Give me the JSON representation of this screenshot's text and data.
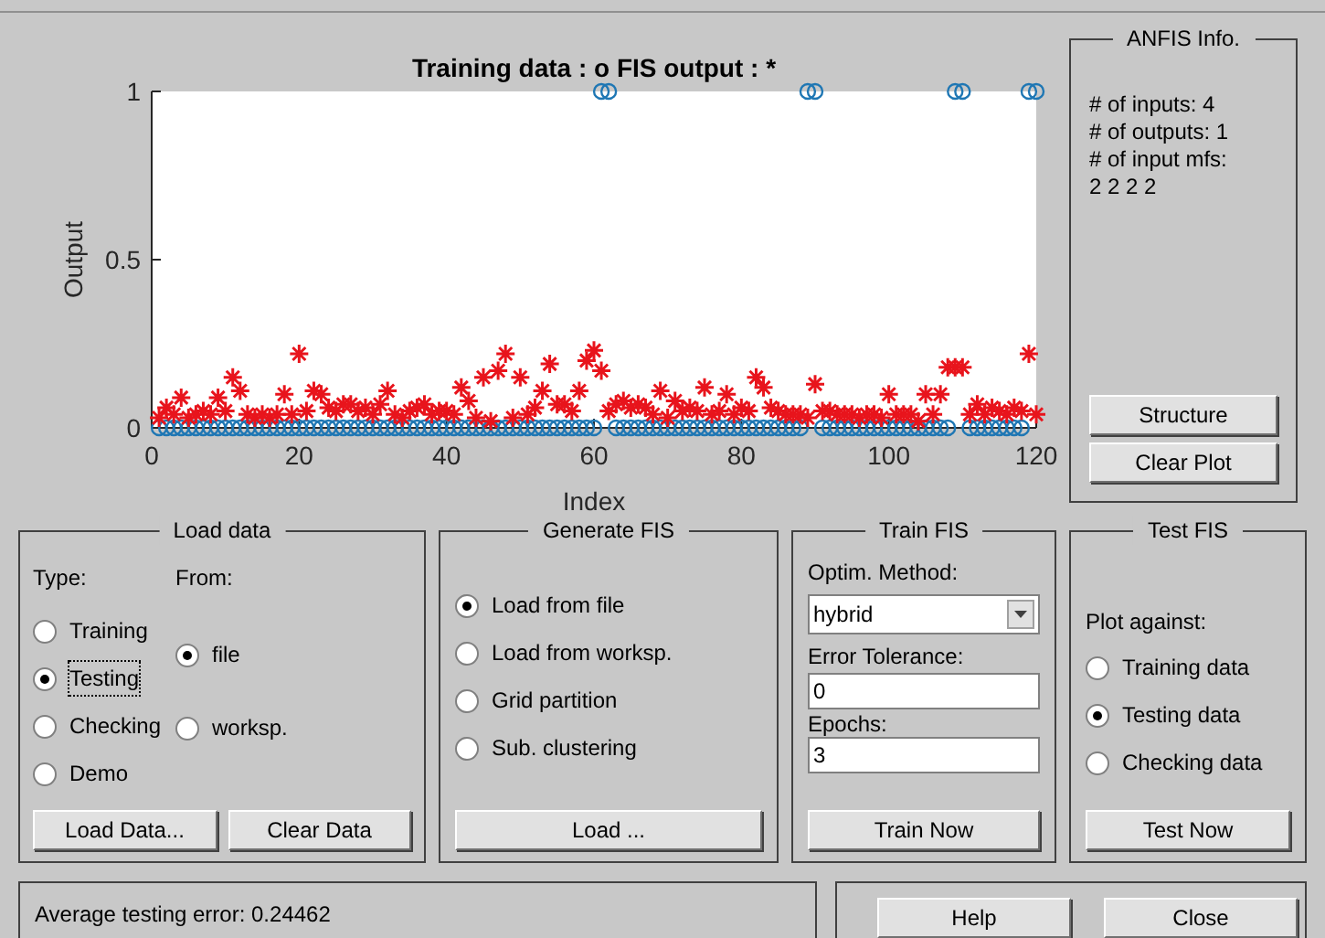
{
  "plot": {
    "chart_data": {
      "type": "scatter",
      "title": "Training data : o   FIS output : *",
      "xlabel": "Index",
      "ylabel": "Output",
      "x": [
        1,
        2,
        3,
        4,
        5,
        6,
        7,
        8,
        9,
        10,
        11,
        12,
        13,
        14,
        15,
        16,
        17,
        18,
        19,
        20,
        21,
        22,
        23,
        24,
        25,
        26,
        27,
        28,
        29,
        30,
        31,
        32,
        33,
        34,
        35,
        36,
        37,
        38,
        39,
        40,
        41,
        42,
        43,
        44,
        45,
        46,
        47,
        48,
        49,
        50,
        51,
        52,
        53,
        54,
        55,
        56,
        57,
        58,
        59,
        60,
        61,
        62,
        63,
        64,
        65,
        66,
        67,
        68,
        69,
        70,
        71,
        72,
        73,
        74,
        75,
        76,
        77,
        78,
        79,
        80,
        81,
        82,
        83,
        84,
        85,
        86,
        87,
        88,
        89,
        90,
        91,
        92,
        93,
        94,
        95,
        96,
        97,
        98,
        99,
        100,
        101,
        102,
        103,
        104,
        105,
        106,
        107,
        108,
        109,
        110,
        111,
        112,
        113,
        114,
        115,
        116,
        117,
        118,
        119,
        120
      ],
      "xlim": [
        0,
        120
      ],
      "ylim": [
        0,
        1
      ],
      "xticks": [
        0,
        20,
        40,
        60,
        80,
        100,
        120
      ],
      "yticks": [
        0,
        0.5,
        1
      ],
      "series": [
        {
          "color": "#1f77b4",
          "marker": "circle",
          "values": [
            0,
            0,
            0,
            0,
            0,
            0,
            0,
            0,
            0,
            0,
            0,
            0,
            0,
            0,
            0,
            0,
            0,
            0,
            0,
            0,
            0,
            0,
            0,
            0,
            0,
            0,
            0,
            0,
            0,
            0,
            0,
            0,
            0,
            0,
            0,
            0,
            0,
            0,
            0,
            0,
            0,
            0,
            0,
            0,
            0,
            0,
            0,
            0,
            0,
            0,
            0,
            0,
            0,
            0,
            0,
            0,
            0,
            0,
            0,
            0,
            1,
            1,
            0,
            0,
            0,
            0,
            0,
            0,
            0,
            0,
            0,
            0,
            0,
            0,
            0,
            0,
            0,
            0,
            0,
            0,
            0,
            0,
            0,
            0,
            0,
            0,
            0,
            0,
            1,
            1,
            0,
            0,
            0,
            0,
            0,
            0,
            0,
            0,
            0,
            0,
            0,
            0,
            0,
            0,
            0,
            0,
            0,
            0,
            1,
            1,
            0,
            0,
            0,
            0,
            0,
            0,
            0,
            0,
            1,
            1
          ]
        },
        {
          "color": "#e8141c",
          "marker": "cross",
          "values": [
            0.03,
            0.06,
            0.04,
            0.09,
            0.03,
            0.04,
            0.05,
            0.04,
            0.09,
            0.05,
            0.15,
            0.11,
            0.04,
            0.03,
            0.04,
            0.03,
            0.04,
            0.1,
            0.04,
            0.22,
            0.05,
            0.11,
            0.1,
            0.06,
            0.05,
            0.07,
            0.07,
            0.05,
            0.06,
            0.04,
            0.07,
            0.11,
            0.04,
            0.03,
            0.05,
            0.06,
            0.07,
            0.04,
            0.05,
            0.05,
            0.04,
            0.12,
            0.08,
            0.03,
            0.15,
            0.02,
            0.17,
            0.22,
            0.03,
            0.15,
            0.04,
            0.06,
            0.11,
            0.19,
            0.07,
            0.07,
            0.05,
            0.11,
            0.2,
            0.23,
            0.17,
            0.05,
            0.07,
            0.08,
            0.06,
            0.07,
            0.06,
            0.04,
            0.11,
            0.03,
            0.08,
            0.05,
            0.06,
            0.05,
            0.12,
            0.04,
            0.05,
            0.1,
            0.04,
            0.06,
            0.05,
            0.15,
            0.12,
            0.06,
            0.05,
            0.04,
            0.04,
            0.04,
            0.03,
            0.13,
            0.05,
            0.05,
            0.04,
            0.04,
            0.04,
            0.03,
            0.04,
            0.04,
            0.03,
            0.1,
            0.04,
            0.04,
            0.04,
            0.02,
            0.1,
            0.04,
            0.1,
            0.18,
            0.18,
            0.18,
            0.04,
            0.07,
            0.04,
            0.06,
            0.05,
            0.04,
            0.06,
            0.05,
            0.22,
            0.04
          ]
        }
      ]
    }
  },
  "info": {
    "title": "ANFIS Info.",
    "lines": [
      "# of inputs: 4",
      "# of outputs: 1",
      "# of input mfs:",
      "2 2 2 2"
    ],
    "buttons": [
      "Structure",
      "Clear Plot"
    ]
  },
  "load_data": {
    "title": "Load data",
    "type_label": "Type:",
    "from_label": "From:",
    "types": [
      {
        "label": "Training",
        "selected": false,
        "focused": false
      },
      {
        "label": "Testing",
        "selected": true,
        "focused": true
      },
      {
        "label": "Checking",
        "selected": false,
        "focused": false
      },
      {
        "label": "Demo",
        "selected": false,
        "focused": false
      }
    ],
    "sources": [
      {
        "label": "file",
        "selected": true
      },
      {
        "label": "worksp.",
        "selected": false
      }
    ],
    "buttons": [
      "Load Data...",
      "Clear Data"
    ]
  },
  "generate_fis": {
    "title": "Generate FIS",
    "options": [
      {
        "label": "Load from file",
        "selected": true
      },
      {
        "label": "Load from worksp.",
        "selected": false
      },
      {
        "label": "Grid partition",
        "selected": false
      },
      {
        "label": "Sub. clustering",
        "selected": false
      }
    ],
    "button": "Load ..."
  },
  "train_fis": {
    "title": "Train FIS",
    "method_label": "Optim. Method:",
    "method": "hybrid",
    "tolerance_label": "Error Tolerance:",
    "tolerance": "0",
    "epochs_label": "Epochs:",
    "epochs": "3",
    "button": "Train Now"
  },
  "test_fis": {
    "title": "Test FIS",
    "plot_label": "Plot against:",
    "options": [
      {
        "label": "Training data",
        "selected": false
      },
      {
        "label": "Testing data",
        "selected": true
      },
      {
        "label": "Checking data",
        "selected": false
      }
    ],
    "button": "Test Now"
  },
  "status": "Average testing error: 0.24462",
  "buttons": [
    "Help",
    "Close"
  ]
}
